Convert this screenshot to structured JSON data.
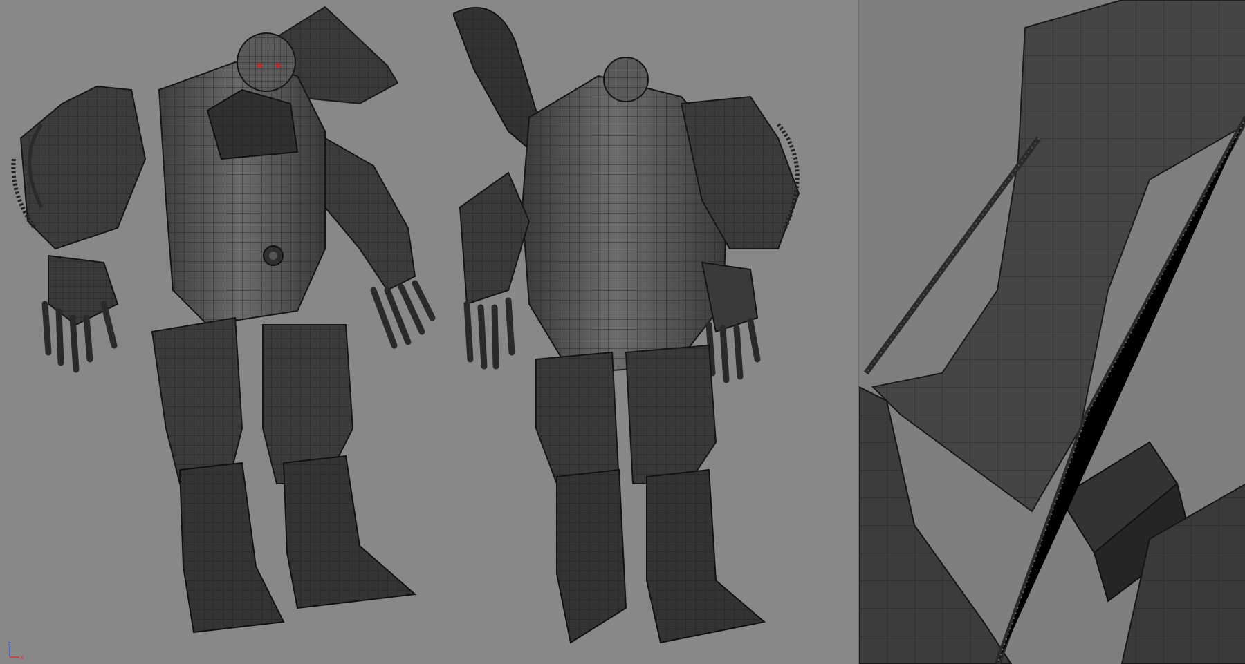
{
  "viewports": [
    {
      "name": "front-perspective",
      "subject": "armored-mech-character-wireframe"
    },
    {
      "name": "back-perspective",
      "subject": "armored-mech-character-wireframe"
    },
    {
      "name": "detail-closeup",
      "subject": "spiked-tube-detail-wireframe"
    }
  ],
  "axis_gizmo": {
    "z_label": "z",
    "x_label": "x",
    "z_color": "#3a5fcf",
    "x_color": "#c83a3a"
  },
  "colors": {
    "background": "#888888",
    "mesh_fill": "#4a4a4a",
    "mesh_light": "#6a6a6a",
    "mesh_dark": "#2e2e2e",
    "wire": "#1c1c1c",
    "eye_accent": "#b03030"
  }
}
